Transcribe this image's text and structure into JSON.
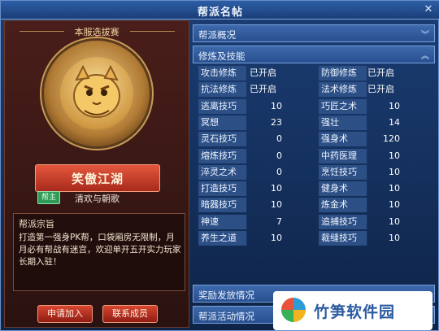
{
  "window": {
    "title": "帮派名帖",
    "close_glyph": "✕"
  },
  "card": {
    "header": "本服选拔赛",
    "guild_name": "笑傲江湖",
    "leader_badge": "帮主",
    "leader_name": "清欢与朝歌",
    "motto_title": "帮派宗旨",
    "motto_text": "打造第一强身PK帮，口袋厢房无限制，月月必有帮战有迷宫，欢迎单开五开实力玩家长期入驻！",
    "apply_label": "申请加入",
    "contact_label": "联系成员"
  },
  "sections": {
    "overview": "帮派概况",
    "skills": "修炼及技能",
    "rewards": "奖励发放情况",
    "activities": "帮派活动情况"
  },
  "skills_left": [
    {
      "label": "攻击修炼",
      "value": "已开启"
    },
    {
      "label": "抗法修炼",
      "value": "已开启"
    },
    {
      "label": "逃离技巧",
      "value": "10"
    },
    {
      "label": "冥想",
      "value": "23"
    },
    {
      "label": "灵石技巧",
      "value": "0"
    },
    {
      "label": "熔炼技巧",
      "value": "0"
    },
    {
      "label": "淬灵之术",
      "value": "0"
    },
    {
      "label": "打造技巧",
      "value": "10"
    },
    {
      "label": "暗器技巧",
      "value": "10"
    },
    {
      "label": "神速",
      "value": "7"
    },
    {
      "label": "养生之道",
      "value": "10"
    }
  ],
  "skills_right": [
    {
      "label": "防御修炼",
      "value": "已开启"
    },
    {
      "label": "法术修炼",
      "value": "已开启"
    },
    {
      "label": "巧匠之术",
      "value": "10"
    },
    {
      "label": "强壮",
      "value": "14"
    },
    {
      "label": "强身术",
      "value": "120"
    },
    {
      "label": "中药医理",
      "value": "10"
    },
    {
      "label": "烹饪技巧",
      "value": "10"
    },
    {
      "label": "健身术",
      "value": "10"
    },
    {
      "label": "炼金术",
      "value": "10"
    },
    {
      "label": "追捕技巧",
      "value": "10"
    },
    {
      "label": "裁缝技巧",
      "value": "10"
    }
  ],
  "watermark": {
    "text": "竹笋软件园"
  }
}
